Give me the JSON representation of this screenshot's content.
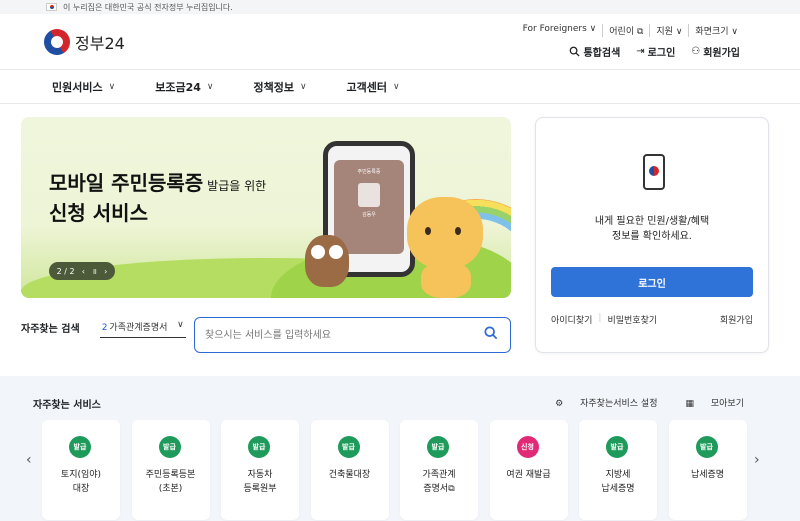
{
  "gov_bar": {
    "text": "이 누리집은 대한민국 공식 전자정부 누리집입니다."
  },
  "header": {
    "logo_text": "정부24",
    "util": [
      "For Foreigners ∨",
      "어린이 ⧉",
      "지원 ∨",
      "화면크기 ∨"
    ],
    "actions": [
      {
        "icon": "search-icon",
        "glyph": "🔍︎",
        "label": "통합검색"
      },
      {
        "icon": "login-icon",
        "glyph": "⇥",
        "label": "로그인"
      },
      {
        "icon": "user-plus-icon",
        "glyph": "⚇",
        "label": "회원가입"
      }
    ]
  },
  "gnb": [
    "민원서비스",
    "보조금24",
    "정책정보",
    "고객센터"
  ],
  "banner": {
    "title1": "모바일 주민등록증",
    "title1_small": "발급을 위한",
    "title2": "신청 서비스",
    "card_header": "주민등록증",
    "card_name": "김동우",
    "pager": {
      "current": "2",
      "total": "2",
      "text": "2 / 2"
    }
  },
  "favorite_search": {
    "label": "자주찾는 검색",
    "select_num": "2",
    "select_value": "가족관계증명서"
  },
  "search": {
    "placeholder": "찾으시는 서비스를 입력하세요"
  },
  "login_panel": {
    "message_line1": "내게 필요한 민원/생활/혜택",
    "message_line2": "정보를 확인하세요.",
    "login_label": "로그인",
    "find_id": "아이디찾기",
    "find_pw": "비밀번호찾기",
    "join": "회원가입"
  },
  "services": {
    "title": "자주찾는 서비스",
    "settings": "자주찾는서비스 설정",
    "view_all": "모아보기",
    "items": [
      {
        "badge": "발급",
        "name": "토지(임야)\n대장"
      },
      {
        "badge": "발급",
        "name": "주민등록등본\n(초본)"
      },
      {
        "badge": "발급",
        "name": "자동차\n등록원부"
      },
      {
        "badge": "발급",
        "name": "건축물대장"
      },
      {
        "badge": "발급",
        "name": "가족관계\n증명서⧉"
      },
      {
        "badge": "신청",
        "name": "여권 재발급"
      },
      {
        "badge": "발급",
        "name": "지방세\n납세증명"
      },
      {
        "badge": "발급",
        "name": "납세증명"
      }
    ]
  },
  "colors": {
    "primary": "#2f73d9",
    "issue_badge": "#1e9a5a",
    "apply_badge": "#e02a76"
  }
}
